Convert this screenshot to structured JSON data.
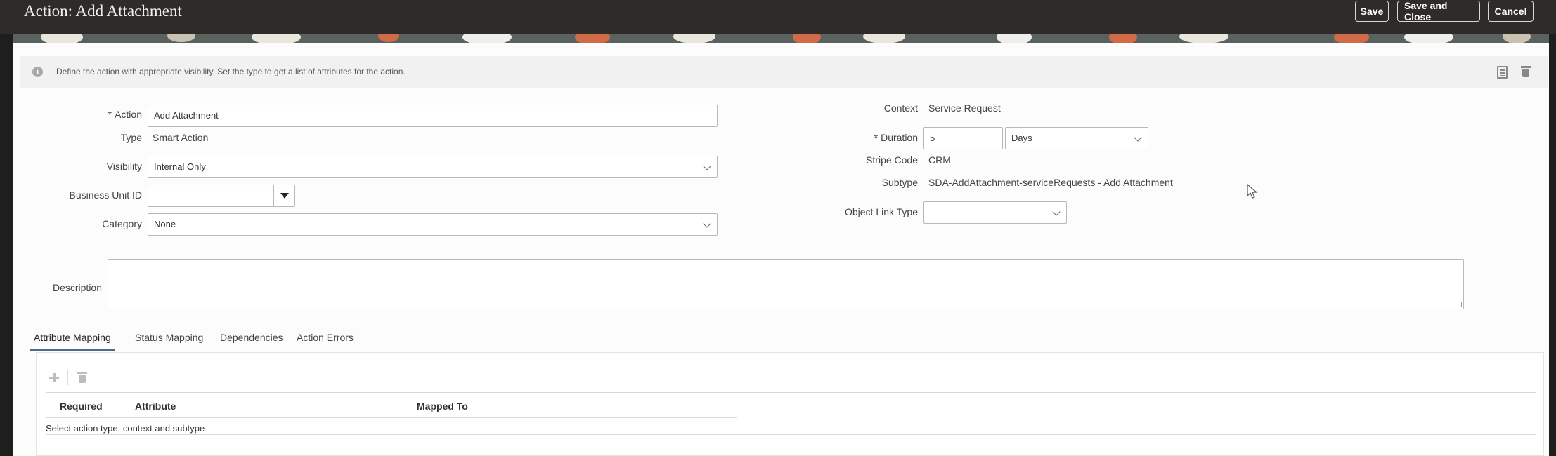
{
  "header": {
    "title": "Action: Add Attachment",
    "save_label": "Save",
    "save_close_label": "Save and Close",
    "cancel_label": "Cancel"
  },
  "info": {
    "text": "Define the action with appropriate visibility. Set the type to get a list of attributes for the action."
  },
  "form_left": {
    "action_label": "Action",
    "action_value": "Add Attachment",
    "type_label": "Type",
    "type_value": "Smart Action",
    "visibility_label": "Visibility",
    "visibility_value": "Internal Only",
    "business_unit_label": "Business Unit ID",
    "business_unit_value": "",
    "category_label": "Category",
    "category_value": "None"
  },
  "form_right": {
    "context_label": "Context",
    "context_value": "Service Request",
    "duration_label": "Duration",
    "duration_value": "5",
    "duration_unit": "Days",
    "stripe_code_label": "Stripe Code",
    "stripe_code_value": "CRM",
    "subtype_label": "Subtype",
    "subtype_value": "SDA-AddAttachment-serviceRequests - Add Attachment",
    "object_link_type_label": "Object Link Type",
    "object_link_type_value": ""
  },
  "description": {
    "label": "Description",
    "value": ""
  },
  "tabs": [
    {
      "label": "Attribute Mapping",
      "active": true
    },
    {
      "label": "Status Mapping",
      "active": false
    },
    {
      "label": "Dependencies",
      "active": false
    },
    {
      "label": "Action Errors",
      "active": false
    }
  ],
  "table": {
    "columns": [
      "Required",
      "Attribute",
      "Mapped To"
    ],
    "empty_text": "Select action type, context and subtype"
  },
  "icons": {
    "info": "info-icon",
    "document": "document-icon",
    "delete": "trash-icon",
    "add": "plus-icon"
  },
  "colors": {
    "header_bg": "#2f2b28",
    "tab_active_underline": "#4f6b8a"
  }
}
